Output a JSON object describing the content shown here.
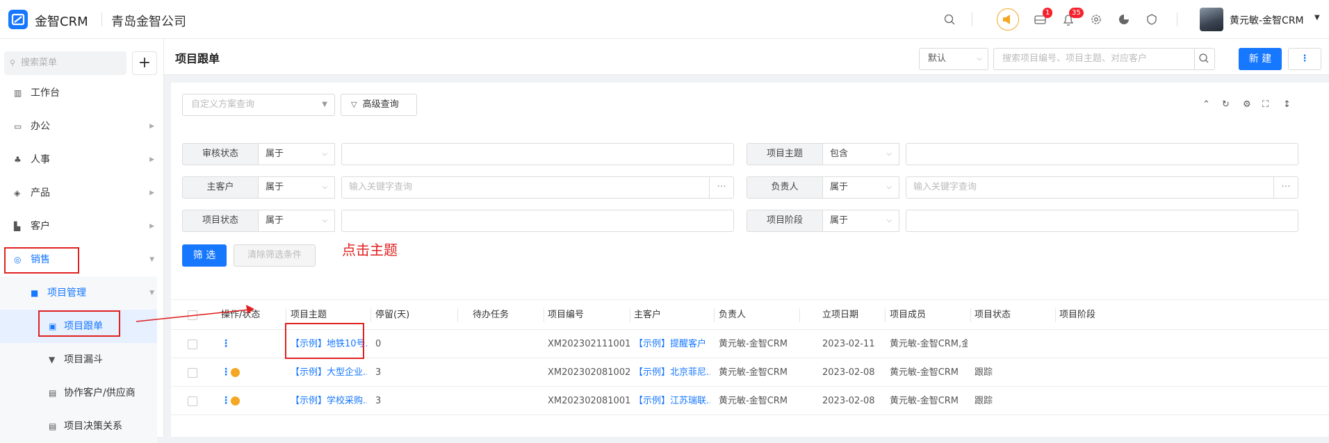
{
  "topbar": {
    "brand": "金智CRM",
    "company": "青岛金智公司",
    "mail_badge": "1",
    "bell_badge": "35",
    "user_name": "黄元敏-金智CRM"
  },
  "sidebar": {
    "search_placeholder": "搜索菜单",
    "add_label": "+",
    "items": [
      {
        "label": "工作台"
      },
      {
        "label": "办公"
      },
      {
        "label": "人事"
      },
      {
        "label": "产品"
      },
      {
        "label": "客户"
      },
      {
        "label": "销售"
      },
      {
        "label": "项目管理"
      },
      {
        "label": "项目跟单"
      },
      {
        "label": "项目漏斗"
      },
      {
        "label": "协作客户/供应商"
      },
      {
        "label": "项目决策关系"
      }
    ]
  },
  "header": {
    "title": "项目跟单",
    "view_select": "默认",
    "search_placeholder": "搜索项目编号、项目主题、对应客户",
    "new_button": "新 建",
    "more_button": "⋮"
  },
  "filters": {
    "scheme_placeholder": "自定义方案查询",
    "advanced_button": "高级查询",
    "rows": [
      {
        "label": "审核状态",
        "op": "属于",
        "placeholder": ""
      },
      {
        "label": "项目主题",
        "op": "包含",
        "placeholder": ""
      },
      {
        "label": "主客户",
        "op": "属于",
        "placeholder": "输入关键字查询"
      },
      {
        "label": "负责人",
        "op": "属于",
        "placeholder": "输入关键字查询"
      },
      {
        "label": "项目状态",
        "op": "属于",
        "placeholder": ""
      },
      {
        "label": "项目阶段",
        "op": "属于",
        "placeholder": ""
      }
    ],
    "filter_button": "筛 选",
    "clear_button": "清除筛选条件",
    "dots": "···"
  },
  "annotation": {
    "text": "点击主题"
  },
  "table": {
    "columns": [
      "操作/状态",
      "项目主题",
      "停留(天)",
      "待办任务",
      "项目编号",
      "主客户",
      "负责人",
      "立项日期",
      "项目成员",
      "项目状态",
      "项目阶段"
    ],
    "rows": [
      {
        "topic": "【示例】地铁10号...",
        "stay": "0",
        "task": "",
        "code": "XM202302111001",
        "customer": "【示例】提醒客户",
        "owner": "黄元敏-金智CRM",
        "date": "2023-02-11",
        "members": "黄元敏-金智CRM,金...",
        "status": "",
        "stage": ""
      },
      {
        "topic": "【示例】大型企业...",
        "stay": "3",
        "task": "",
        "code": "XM202302081002",
        "customer": "【示例】北京菲尼...",
        "owner": "黄元敏-金智CRM",
        "date": "2023-02-08",
        "members": "黄元敏-金智CRM",
        "status": "跟踪",
        "stage": ""
      },
      {
        "topic": "【示例】学校采购...",
        "stay": "3",
        "task": "",
        "code": "XM202302081001",
        "customer": "【示例】江苏瑞联...",
        "owner": "黄元敏-金智CRM",
        "date": "2023-02-08",
        "members": "黄元敏-金智CRM",
        "status": "跟踪",
        "stage": ""
      }
    ]
  },
  "colors": {
    "accent": "#1677ff",
    "highlight": "#e02020",
    "play": "#f5a623"
  }
}
